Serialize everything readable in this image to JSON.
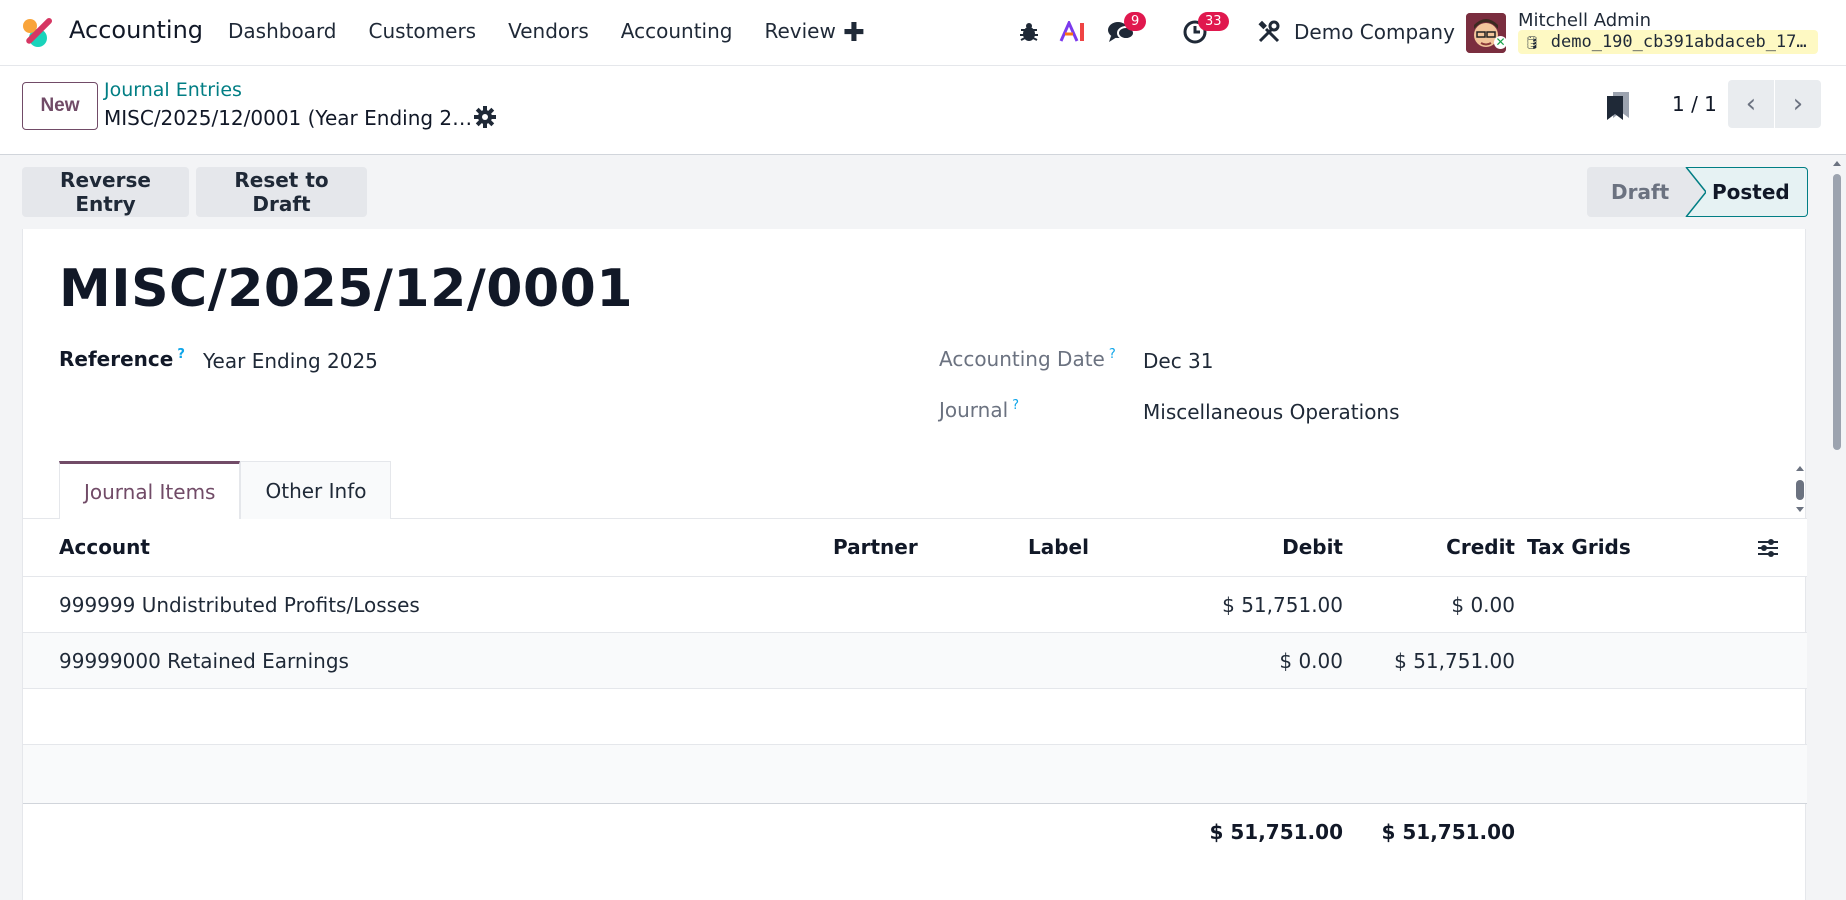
{
  "app": {
    "name": "Accounting"
  },
  "menu": [
    "Dashboard",
    "Customers",
    "Vendors",
    "Accounting",
    "Review"
  ],
  "systray": {
    "messages_count": "9",
    "activities_count": "33",
    "company": "Demo Company"
  },
  "user": {
    "name": "Mitchell Admin",
    "database": "demo_190_cb391abdaceb_17…"
  },
  "control": {
    "new_label": "New",
    "breadcrumb": "Journal Entries",
    "record": "MISC/2025/12/0001 (Year Ending 2…",
    "pager": "1 / 1"
  },
  "actions": {
    "reverse": "Reverse Entry",
    "reset": "Reset to Draft"
  },
  "status": {
    "draft": "Draft",
    "posted": "Posted"
  },
  "entry": {
    "title": "MISC/2025/12/0001",
    "reference_label": "Reference",
    "reference": "Year Ending 2025",
    "date_label": "Accounting Date",
    "date": "Dec 31",
    "journal_label": "Journal",
    "journal": "Miscellaneous Operations",
    "help_mark": "?"
  },
  "tabs": [
    "Journal Items",
    "Other Info"
  ],
  "table": {
    "headers": {
      "account": "Account",
      "partner": "Partner",
      "label": "Label",
      "debit": "Debit",
      "credit": "Credit",
      "tax": "Tax Grids"
    },
    "rows": [
      {
        "account": "999999 Undistributed Profits/Losses",
        "debit": "$ 51,751.00",
        "credit": "$ 0.00"
      },
      {
        "account": "99999000 Retained Earnings",
        "debit": "$ 0.00",
        "credit": "$ 51,751.00"
      }
    ],
    "totals": {
      "debit": "$ 51,751.00",
      "credit": "$ 51,751.00"
    }
  },
  "colors": {
    "brand": "#714b67",
    "link": "#017e84",
    "badge": "#e0184e"
  }
}
